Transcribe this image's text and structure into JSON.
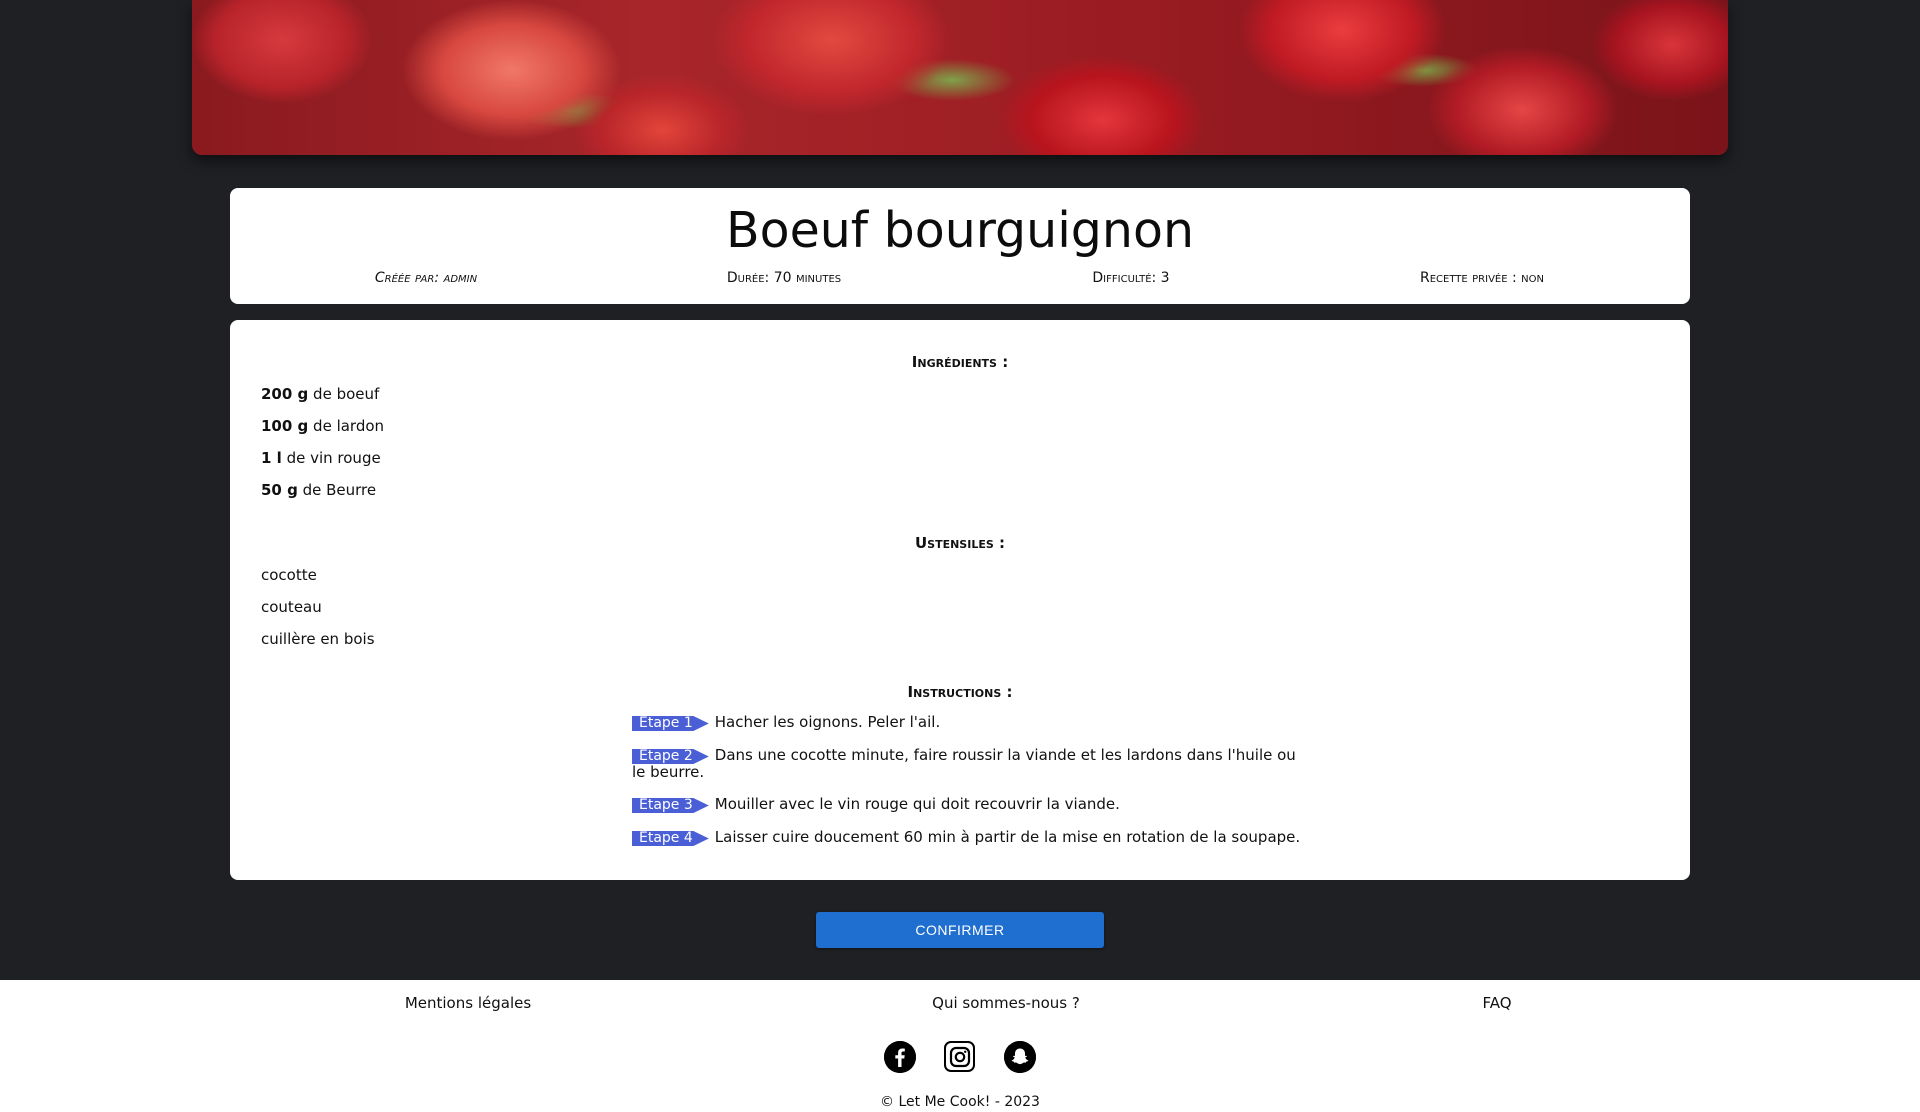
{
  "recipe": {
    "title": "Boeuf bourguignon",
    "meta": {
      "author_label": "Créée par: admin",
      "duration_label": "Durée: 70 minutes",
      "difficulty_label": "Difficulté: 3",
      "private_label": "Recette privée : non"
    }
  },
  "ingredients": {
    "title": "Ingrédients :",
    "items": [
      {
        "qty": "200 g",
        "text": " de boeuf"
      },
      {
        "qty": "100 g",
        "text": " de lardon"
      },
      {
        "qty": "1 l",
        "text": " de vin rouge"
      },
      {
        "qty": "50 g",
        "text": " de Beurre"
      }
    ]
  },
  "utensils": {
    "title": "Ustensiles :",
    "items": [
      "cocotte",
      "couteau",
      "cuillère en bois"
    ]
  },
  "instructions": {
    "title": "Instructions :",
    "steps": [
      {
        "tag": "Etape 1",
        "text": "Hacher les oignons. Peler l'ail."
      },
      {
        "tag": "Etape 2",
        "text": "Dans une cocotte minute, faire roussir la viande et les lardons dans l'huile ou le beurre."
      },
      {
        "tag": "Etape 3",
        "text": "Mouiller avec le vin rouge qui doit recouvrir la viande."
      },
      {
        "tag": "Etape 4",
        "text": "Laisser cuire doucement 60 min à partir de la mise en rotation de la soupape."
      }
    ]
  },
  "actions": {
    "confirm_label": "CONFIRMER"
  },
  "footer": {
    "legal": "Mentions légales",
    "about": "Qui sommes-nous ?",
    "faq": "FAQ",
    "socials": [
      {
        "icon": "facebook-icon",
        "glyph": "f"
      },
      {
        "icon": "instagram-icon",
        "glyph": "◎"
      },
      {
        "icon": "snapchat-icon",
        "glyph": "♟"
      }
    ],
    "copyright": "© Let Me Cook! - 2023"
  },
  "colors": {
    "background": "#1e2024",
    "accent": "#1e6fd0",
    "step_tag": "#4a5fd6"
  }
}
